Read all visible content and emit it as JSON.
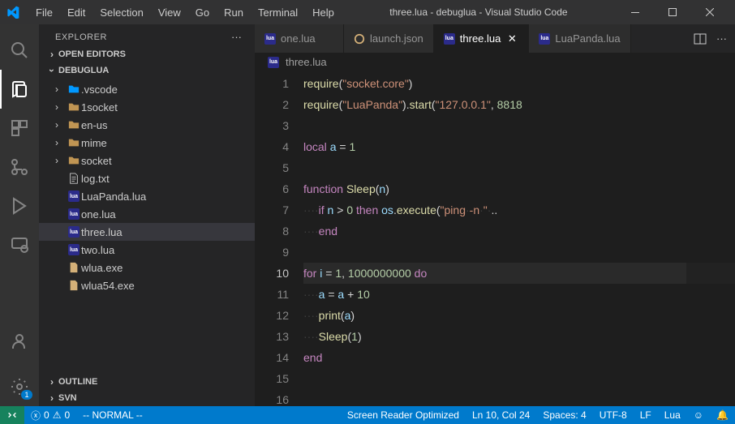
{
  "title_bar": {
    "title": "three.lua - debuglua - Visual Studio Code",
    "menu": [
      "File",
      "Edit",
      "Selection",
      "View",
      "Go",
      "Run",
      "Terminal",
      "Help"
    ]
  },
  "sidebar": {
    "title": "EXPLORER",
    "sections": {
      "open_editors": "OPEN EDITORS",
      "project": "DEBUGLUA",
      "outline": "OUTLINE",
      "svn": "SVN"
    },
    "tree": [
      {
        "type": "folder",
        "label": ".vscode",
        "icon": "vscode-folder"
      },
      {
        "type": "folder",
        "label": "1socket",
        "icon": "folder"
      },
      {
        "type": "folder",
        "label": "en-us",
        "icon": "folder"
      },
      {
        "type": "folder",
        "label": "mime",
        "icon": "folder"
      },
      {
        "type": "folder",
        "label": "socket",
        "icon": "folder"
      },
      {
        "type": "file",
        "label": "log.txt",
        "icon": "text"
      },
      {
        "type": "file",
        "label": "LuaPanda.lua",
        "icon": "lua"
      },
      {
        "type": "file",
        "label": "one.lua",
        "icon": "lua"
      },
      {
        "type": "file",
        "label": "three.lua",
        "icon": "lua",
        "active": true
      },
      {
        "type": "file",
        "label": "two.lua",
        "icon": "lua"
      },
      {
        "type": "file",
        "label": "wlua.exe",
        "icon": "exe"
      },
      {
        "type": "file",
        "label": "wlua54.exe",
        "icon": "exe"
      }
    ]
  },
  "tabs": [
    {
      "label": "one.lua",
      "icon": "lua",
      "active": false
    },
    {
      "label": "launch.json",
      "icon": "json",
      "active": false
    },
    {
      "label": "three.lua",
      "icon": "lua",
      "active": true
    },
    {
      "label": "LuaPanda.lua",
      "icon": "lua",
      "active": false
    }
  ],
  "breadcrumb": {
    "icon": "lua",
    "label": "three.lua"
  },
  "code": {
    "lines": [
      {
        "n": 1,
        "tokens": [
          {
            "t": "fn",
            "v": "require"
          },
          {
            "t": "op",
            "v": "("
          },
          {
            "t": "str",
            "v": "\"socket.core\""
          },
          {
            "t": "op",
            "v": ")"
          }
        ]
      },
      {
        "n": 2,
        "tokens": [
          {
            "t": "fn",
            "v": "require"
          },
          {
            "t": "op",
            "v": "("
          },
          {
            "t": "str",
            "v": "\"LuaPanda\""
          },
          {
            "t": "op",
            "v": ")."
          },
          {
            "t": "fn",
            "v": "start"
          },
          {
            "t": "op",
            "v": "("
          },
          {
            "t": "str",
            "v": "\"127.0.0.1\""
          },
          {
            "t": "op",
            "v": ", "
          },
          {
            "t": "num",
            "v": "8818"
          }
        ]
      },
      {
        "n": 3,
        "tokens": []
      },
      {
        "n": 4,
        "tokens": [
          {
            "t": "kw",
            "v": "local"
          },
          {
            "t": "op",
            "v": " "
          },
          {
            "t": "id",
            "v": "a"
          },
          {
            "t": "op",
            "v": " = "
          },
          {
            "t": "num",
            "v": "1"
          }
        ]
      },
      {
        "n": 5,
        "tokens": []
      },
      {
        "n": 6,
        "tokens": [
          {
            "t": "kw",
            "v": "function"
          },
          {
            "t": "op",
            "v": " "
          },
          {
            "t": "fn",
            "v": "Sleep"
          },
          {
            "t": "op",
            "v": "("
          },
          {
            "t": "id",
            "v": "n"
          },
          {
            "t": "op",
            "v": ")"
          }
        ]
      },
      {
        "n": 7,
        "tokens": [
          {
            "t": "ws",
            "v": "····"
          },
          {
            "t": "kw",
            "v": "if"
          },
          {
            "t": "op",
            "v": " "
          },
          {
            "t": "id",
            "v": "n"
          },
          {
            "t": "op",
            "v": " > "
          },
          {
            "t": "num",
            "v": "0"
          },
          {
            "t": "op",
            "v": " "
          },
          {
            "t": "kw",
            "v": "then"
          },
          {
            "t": "op",
            "v": " "
          },
          {
            "t": "id",
            "v": "os"
          },
          {
            "t": "op",
            "v": "."
          },
          {
            "t": "fn",
            "v": "execute"
          },
          {
            "t": "op",
            "v": "("
          },
          {
            "t": "str",
            "v": "\"ping·-n·\""
          },
          {
            "t": "op",
            "v": "·.."
          }
        ]
      },
      {
        "n": 8,
        "tokens": [
          {
            "t": "ws",
            "v": "····"
          },
          {
            "t": "kw",
            "v": "end"
          }
        ]
      },
      {
        "n": 9,
        "tokens": []
      },
      {
        "n": 10,
        "hl": true,
        "tokens": [
          {
            "t": "kw",
            "v": "for"
          },
          {
            "t": "op",
            "v": " "
          },
          {
            "t": "id",
            "v": "i"
          },
          {
            "t": "op",
            "v": " = "
          },
          {
            "t": "num",
            "v": "1"
          },
          {
            "t": "op",
            "v": ", "
          },
          {
            "t": "num",
            "v": "1000000000"
          },
          {
            "t": "op",
            "v": " "
          },
          {
            "t": "kw",
            "v": "do"
          }
        ]
      },
      {
        "n": 11,
        "tokens": [
          {
            "t": "ws",
            "v": "····"
          },
          {
            "t": "id",
            "v": "a"
          },
          {
            "t": "op",
            "v": " = "
          },
          {
            "t": "id",
            "v": "a"
          },
          {
            "t": "op",
            "v": " + "
          },
          {
            "t": "num",
            "v": "10"
          }
        ]
      },
      {
        "n": 12,
        "tokens": [
          {
            "t": "ws",
            "v": "····"
          },
          {
            "t": "fn",
            "v": "print"
          },
          {
            "t": "op",
            "v": "("
          },
          {
            "t": "id",
            "v": "a"
          },
          {
            "t": "op",
            "v": ")"
          }
        ]
      },
      {
        "n": 13,
        "tokens": [
          {
            "t": "ws",
            "v": "····"
          },
          {
            "t": "fn",
            "v": "Sleep"
          },
          {
            "t": "op",
            "v": "("
          },
          {
            "t": "num",
            "v": "1"
          },
          {
            "t": "op",
            "v": ")"
          }
        ]
      },
      {
        "n": 14,
        "tokens": [
          {
            "t": "kw",
            "v": "end"
          }
        ]
      },
      {
        "n": 15,
        "tokens": []
      },
      {
        "n": 16,
        "tokens": []
      }
    ]
  },
  "status": {
    "errors": "0",
    "warnings": "0",
    "mode": "-- NORMAL --",
    "reader": "Screen Reader Optimized",
    "position": "Ln 10, Col 24",
    "spaces": "Spaces: 4",
    "encoding": "UTF-8",
    "eol": "LF",
    "lang": "Lua"
  },
  "settings_badge": "1"
}
